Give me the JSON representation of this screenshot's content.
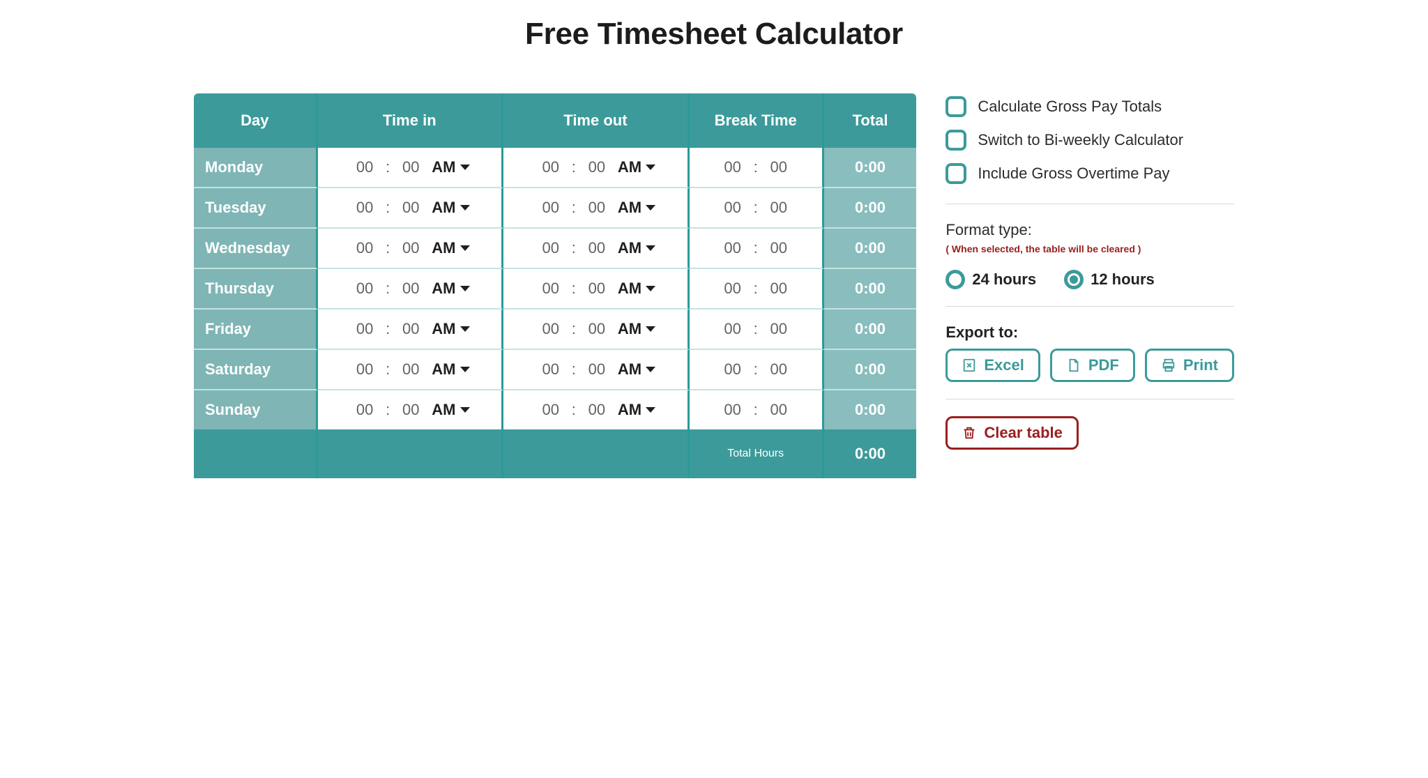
{
  "title": "Free Timesheet Calculator",
  "table": {
    "headers": {
      "day": "Day",
      "time_in": "Time in",
      "time_out": "Time out",
      "break": "Break Time",
      "total": "Total"
    },
    "rows": [
      {
        "day": "Monday",
        "in_h": "00",
        "in_m": "00",
        "in_ampm": "AM",
        "out_h": "00",
        "out_m": "00",
        "out_ampm": "AM",
        "break_h": "00",
        "break_m": "00",
        "total": "0:00"
      },
      {
        "day": "Tuesday",
        "in_h": "00",
        "in_m": "00",
        "in_ampm": "AM",
        "out_h": "00",
        "out_m": "00",
        "out_ampm": "AM",
        "break_h": "00",
        "break_m": "00",
        "total": "0:00"
      },
      {
        "day": "Wednesday",
        "in_h": "00",
        "in_m": "00",
        "in_ampm": "AM",
        "out_h": "00",
        "out_m": "00",
        "out_ampm": "AM",
        "break_h": "00",
        "break_m": "00",
        "total": "0:00"
      },
      {
        "day": "Thursday",
        "in_h": "00",
        "in_m": "00",
        "in_ampm": "AM",
        "out_h": "00",
        "out_m": "00",
        "out_ampm": "AM",
        "break_h": "00",
        "break_m": "00",
        "total": "0:00"
      },
      {
        "day": "Friday",
        "in_h": "00",
        "in_m": "00",
        "in_ampm": "AM",
        "out_h": "00",
        "out_m": "00",
        "out_ampm": "AM",
        "break_h": "00",
        "break_m": "00",
        "total": "0:00"
      },
      {
        "day": "Saturday",
        "in_h": "00",
        "in_m": "00",
        "in_ampm": "AM",
        "out_h": "00",
        "out_m": "00",
        "out_ampm": "AM",
        "break_h": "00",
        "break_m": "00",
        "total": "0:00"
      },
      {
        "day": "Sunday",
        "in_h": "00",
        "in_m": "00",
        "in_ampm": "AM",
        "out_h": "00",
        "out_m": "00",
        "out_ampm": "AM",
        "break_h": "00",
        "break_m": "00",
        "total": "0:00"
      }
    ],
    "footer": {
      "label": "Total Hours",
      "value": "0:00"
    }
  },
  "options": {
    "gross_pay_label": "Calculate Gross Pay Totals",
    "biweekly_label": "Switch to Bi-weekly Calculator",
    "overtime_label": "Include Gross Overtime Pay"
  },
  "format": {
    "label": "Format type:",
    "warning": "( When selected, the table will be cleared )",
    "option24": "24 hours",
    "option12": "12 hours",
    "selected": "12"
  },
  "export": {
    "label": "Export to:",
    "excel": "Excel",
    "pdf": "PDF",
    "print": "Print"
  },
  "clear_label": "Clear table"
}
